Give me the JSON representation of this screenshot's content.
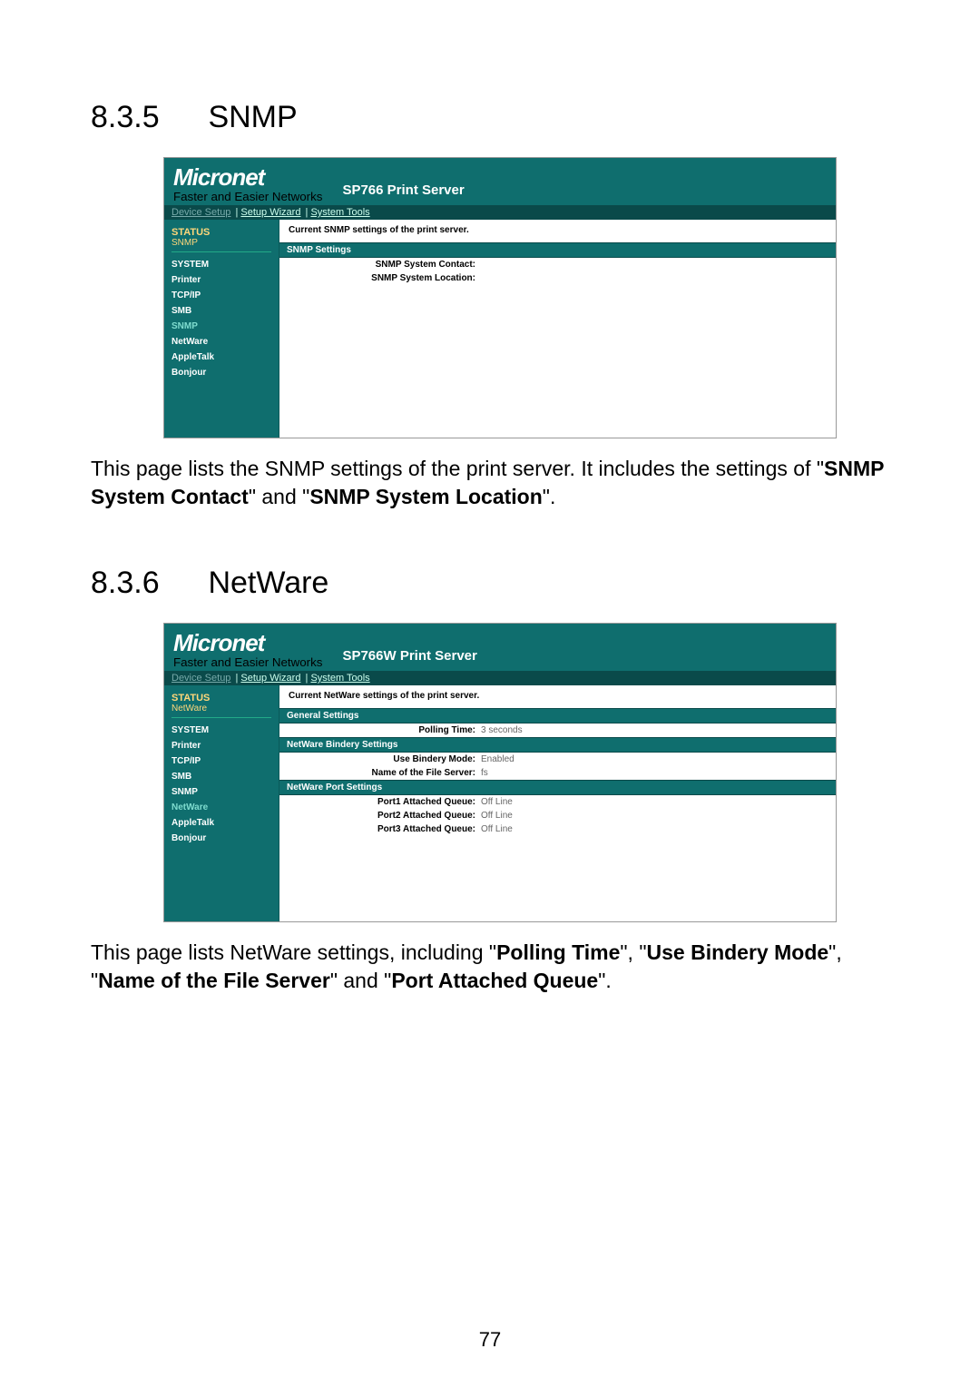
{
  "page_number": "77",
  "section1": {
    "heading_num": "8.3.5",
    "heading_title": "SNMP",
    "body_pre1": "This page lists the SNMP settings of the print server. It includes the settings of \"",
    "bold1": "SNMP System Contact",
    "body_mid1": "\" and \"",
    "bold2": "SNMP System Location",
    "body_post1": "\"."
  },
  "section2": {
    "heading_num": "8.3.6",
    "heading_title": "NetWare",
    "body_pre": "This page lists NetWare settings, including \"",
    "b1": "Polling Time",
    "m1": "\", \"",
    "b2": "Use Bindery Mode",
    "m2": "\", \"",
    "b3": "Name of the File Server",
    "m3": "\" and \"",
    "b4": "Port Attached Queue",
    "post": "\"."
  },
  "shot1": {
    "logo": "Micronet",
    "tagline": "Faster and Easier Networks",
    "title": "SP766 Print Server",
    "nav": {
      "device": "Device Setup",
      "wizard": "Setup Wizard",
      "tools": "System Tools"
    },
    "crumb1": "STATUS",
    "crumb2": "SNMP",
    "side": [
      "SYSTEM",
      "Printer",
      "TCP/IP",
      "SMB",
      "SNMP",
      "NetWare",
      "AppleTalk",
      "Bonjour"
    ],
    "side_selected": "SNMP",
    "lead": "Current SNMP settings of the print server.",
    "bar1": "SNMP Settings",
    "rows": [
      {
        "k": "SNMP System Contact:",
        "v": ""
      },
      {
        "k": "SNMP System Location:",
        "v": ""
      }
    ]
  },
  "shot2": {
    "logo": "Micronet",
    "tagline": "Faster and Easier Networks",
    "title": "SP766W Print Server",
    "nav": {
      "device": "Device Setup",
      "wizard": "Setup Wizard",
      "tools": "System Tools"
    },
    "crumb1": "STATUS",
    "crumb2": "NetWare",
    "side": [
      "SYSTEM",
      "Printer",
      "TCP/IP",
      "SMB",
      "SNMP",
      "NetWare",
      "AppleTalk",
      "Bonjour"
    ],
    "side_selected": "NetWare",
    "lead": "Current NetWare settings of the print server.",
    "bar1": "General Settings",
    "rows1": [
      {
        "k": "Polling Time:",
        "v": "3 seconds"
      }
    ],
    "bar2": "NetWare Bindery Settings",
    "rows2": [
      {
        "k": "Use Bindery Mode:",
        "v": "Enabled"
      },
      {
        "k": "Name of the File Server:",
        "v": "fs"
      }
    ],
    "bar3": "NetWare Port Settings",
    "rows3": [
      {
        "k": "Port1 Attached Queue:",
        "v": "Off Line"
      },
      {
        "k": "Port2 Attached Queue:",
        "v": "Off Line"
      },
      {
        "k": "Port3 Attached Queue:",
        "v": "Off Line"
      }
    ]
  }
}
